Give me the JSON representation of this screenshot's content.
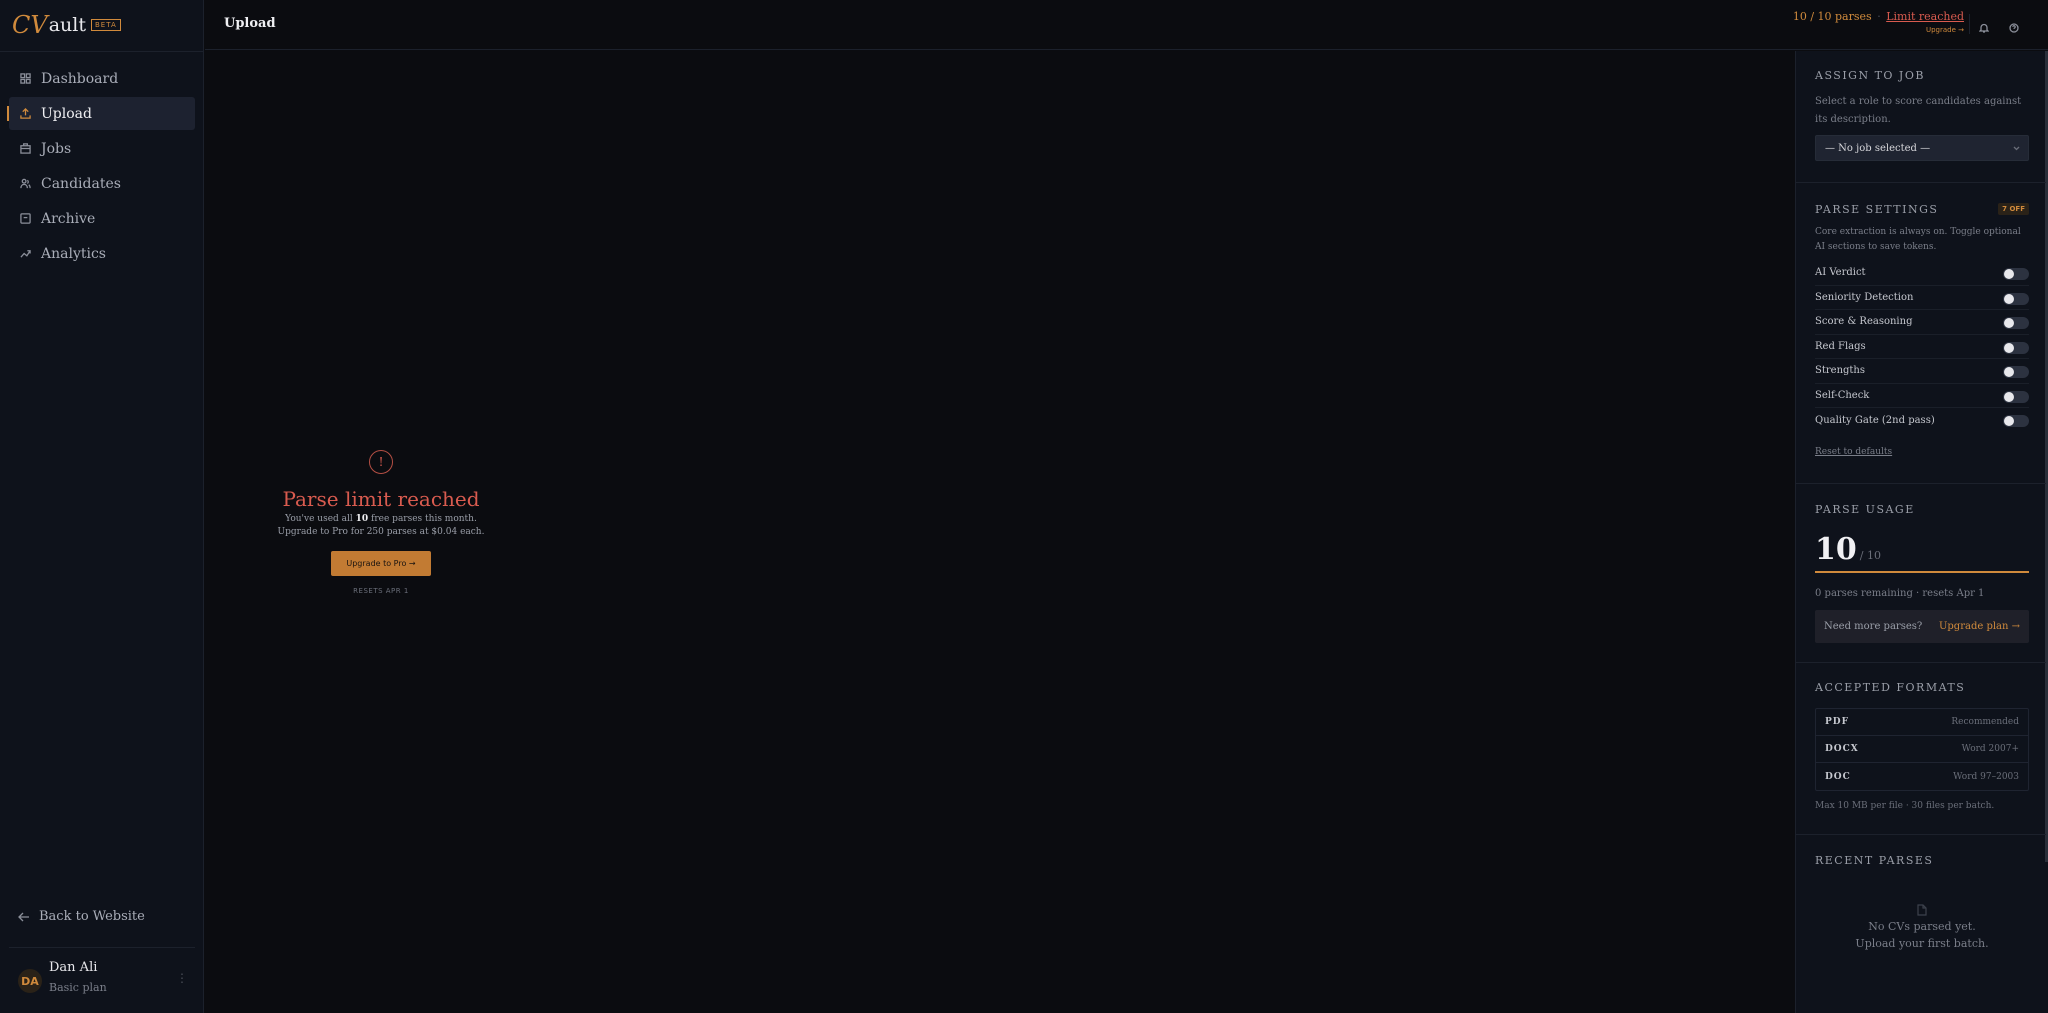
{
  "brand": {
    "logo_cv": "CV",
    "logo_rest": "ault",
    "badge": "BETA"
  },
  "sidebar": {
    "items": [
      {
        "label": "Dashboard",
        "icon": "grid-icon"
      },
      {
        "label": "Upload",
        "icon": "upload-icon",
        "active": true
      },
      {
        "label": "Jobs",
        "icon": "briefcase-icon"
      },
      {
        "label": "Candidates",
        "icon": "users-icon"
      },
      {
        "label": "Archive",
        "icon": "archive-icon"
      },
      {
        "label": "Analytics",
        "icon": "trend-icon"
      }
    ],
    "back_link": "Back to Website",
    "user": {
      "initials": "DA",
      "name": "Dan Ali",
      "plan": "Basic plan"
    }
  },
  "topbar": {
    "title": "Upload",
    "usage_count": "10 / 10 parses",
    "separator": "·",
    "limit_text": "Limit reached",
    "upgrade_label": "Upgrade →"
  },
  "main": {
    "empty_title": "Parse limit reached",
    "line1_pre": "You've used all ",
    "line1_bold": "10",
    "line1_post": " free parses this month.",
    "line2": "Upgrade to Pro for 250 parses at $0.04 each.",
    "button": "Upgrade to Pro →",
    "resets": "RESETS APR 1"
  },
  "panel": {
    "assign": {
      "title": "ASSIGN TO JOB",
      "desc": "Select a role to score candidates against its description.",
      "select_value": "— No job selected —"
    },
    "settings": {
      "title": "PARSE SETTINGS",
      "badge": "7 OFF",
      "desc": "Core extraction is always on. Toggle optional AI sections to save tokens.",
      "toggles": [
        {
          "label": "AI Verdict",
          "on": false
        },
        {
          "label": "Seniority Detection",
          "on": false
        },
        {
          "label": "Score & Reasoning",
          "on": false
        },
        {
          "label": "Red Flags",
          "on": false
        },
        {
          "label": "Strengths",
          "on": false
        },
        {
          "label": "Self-Check",
          "on": false
        },
        {
          "label": "Quality Gate (2nd pass)",
          "on": false
        }
      ],
      "reset_link": "Reset to defaults"
    },
    "usage": {
      "title": "PARSE USAGE",
      "used": "10",
      "max": "/ 10",
      "fill_fraction": 1.0,
      "note": "0 parses remaining · resets Apr 1",
      "need_more": "Need more parses?",
      "upgrade_link": "Upgrade plan →"
    },
    "formats": {
      "title": "ACCEPTED FORMATS",
      "rows": [
        {
          "name": "PDF",
          "desc": "Recommended"
        },
        {
          "name": "DOCX",
          "desc": "Word 2007+"
        },
        {
          "name": "DOC",
          "desc": "Word 97–2003"
        }
      ],
      "note": "Max 10 MB per file · 30 files per batch."
    },
    "recent": {
      "title": "RECENT PARSES",
      "empty_line1": "No CVs parsed yet.",
      "empty_line2": "Upload your first batch."
    }
  },
  "colors": {
    "accent": "#d08a3c",
    "danger": "#d95b4f",
    "background": "#0b0c10",
    "sidebar": "#0e121b"
  }
}
